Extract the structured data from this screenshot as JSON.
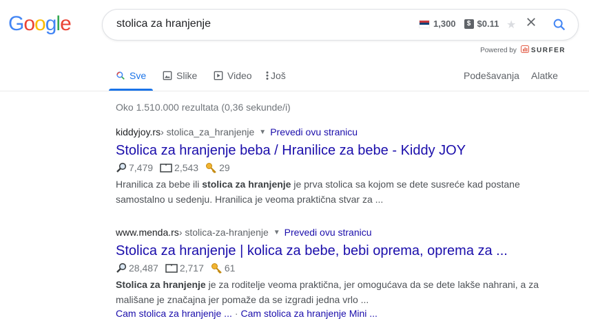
{
  "logo": {
    "text": [
      "G",
      "o",
      "o",
      "g",
      "l",
      "e"
    ],
    "colors": [
      "#4285F4",
      "#EA4335",
      "#FBBC05",
      "#4285F4",
      "#34A853",
      "#EA4335"
    ]
  },
  "search": {
    "query": "stolica za hranjenje"
  },
  "surfer": {
    "country_volume": "1,300",
    "cpc": "$0.11",
    "dollar_glyph": "$",
    "powered_by": "Powered by",
    "brand": "SURFER"
  },
  "tabs": [
    {
      "label": "Sve",
      "icon": "search-icon",
      "active": true
    },
    {
      "label": "Slike",
      "icon": "image-icon"
    },
    {
      "label": "Video",
      "icon": "video-icon"
    },
    {
      "label": "Još",
      "icon": "more-icon"
    }
  ],
  "tools": {
    "settings": "Podešavanja",
    "tools": "Alatke"
  },
  "stats": "Oko 1.510.000 rezultata (0,36 sekunde/i)",
  "results": [
    {
      "domain": "kiddyjoy.rs",
      "path": " › stolica_za_hranjenje",
      "translate": "Prevedi ovu stranicu",
      "title": "Stolica za hranjenje beba / Hranilice za bebe - Kiddy JOY",
      "metrics": {
        "searches": "7,479",
        "pages": "2,543",
        "keywords": "29"
      },
      "snippet_pre": "Hranilica za bebe ili ",
      "snippet_bold": "stolica za hranjenje",
      "snippet_post": " je prva stolica sa kojom se dete susreće kad postane samostalno u sedenju. Hranilica je veoma praktična stvar za ..."
    },
    {
      "domain": "www.menda.rs",
      "path": " › stolica-za-hranjenje",
      "translate": "Prevedi ovu stranicu",
      "title": "Stolica za hranjenje | kolica za bebe, bebi oprema, oprema za ...",
      "metrics": {
        "searches": "28,487",
        "pages": "2,717",
        "keywords": "61"
      },
      "snippet_pre": "",
      "snippet_bold": "Stolica za hranjenje",
      "snippet_post": " je za roditelje veoma praktična, jer omogućava da se dete lakše nahrani, a za mališane je značajna jer pomaže da se izgradi jedna vrlo ...",
      "sitelinks": [
        "Cam stolica za hranjenje ...",
        "Cam stolica za hranjenje Mini ..."
      ],
      "sitelink_sep": "·"
    }
  ]
}
